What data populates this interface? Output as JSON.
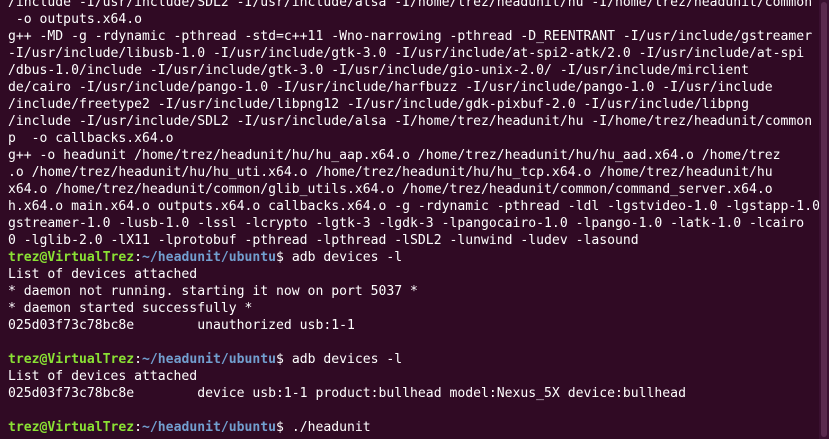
{
  "terminal": {
    "background": "#300a24",
    "text_color": "#ffffff",
    "prompt_user_color": "#8ae234",
    "prompt_path_color": "#729fcf",
    "lines": [
      "/include -I/usr/include/SDL2 -I/usr/include/alsa -I/home/trez/headunit/hu -I/home/trez/headunit/common",
      " -o outputs.x64.o",
      "g++ -MD -g -rdynamic -pthread -std=c++11 -Wno-narrowing -pthread -D_REENTRANT -I/usr/include/gstreamer",
      "-I/usr/include/libusb-1.0 -I/usr/include/gtk-3.0 -I/usr/include/at-spi2-atk/2.0 -I/usr/include/at-spi",
      "/dbus-1.0/include -I/usr/include/gtk-3.0 -I/usr/include/gio-unix-2.0/ -I/usr/include/mirclient",
      "de/cairo -I/usr/include/pango-1.0 -I/usr/include/harfbuzz -I/usr/include/pango-1.0 -I/usr/include",
      "/include/freetype2 -I/usr/include/libpng12 -I/usr/include/gdk-pixbuf-2.0 -I/usr/include/libpng",
      "/include -I/usr/include/SDL2 -I/usr/include/alsa -I/home/trez/headunit/hu -I/home/trez/headunit/common",
      "p  -o callbacks.x64.o",
      "g++ -o headunit /home/trez/headunit/hu/hu_aap.x64.o /home/trez/headunit/hu/hu_aad.x64.o /home/trez",
      ".o /home/trez/headunit/hu/hu_uti.x64.o /home/trez/headunit/hu/hu_tcp.x64.o /home/trez/headunit/hu",
      "x64.o /home/trez/headunit/common/glib_utils.x64.o /home/trez/headunit/common/command_server.x64.o",
      "h.x64.o main.x64.o outputs.x64.o callbacks.x64.o -g -rdynamic -pthread -ldl -lgstvideo-1.0 -lgstapp-1.0",
      "gstreamer-1.0 -lusb-1.0 -lssl -lcrypto -lgtk-3 -lgdk-3 -lpangocairo-1.0 -lpango-1.0 -latk-1.0 -lcairo",
      "0 -lglib-2.0 -lX11 -lprotobuf -pthread -lpthread -lSDL2 -lunwind -ludev -lasound",
      {
        "user": "trez@VirtualTrez",
        "sep": ":",
        "path": "~/headunit/ubuntu",
        "symbol": "$",
        "cmd": " adb devices -l"
      },
      "List of devices attached",
      "* daemon not running. starting it now on port 5037 *",
      "* daemon started successfully *",
      "025d03f73c78bc8e        unauthorized usb:1-1",
      "",
      {
        "user": "trez@VirtualTrez",
        "sep": ":",
        "path": "~/headunit/ubuntu",
        "symbol": "$",
        "cmd": " adb devices -l"
      },
      "List of devices attached",
      "025d03f73c78bc8e        device usb:1-1 product:bullhead model:Nexus_5X device:bullhead",
      "",
      {
        "user": "trez@VirtualTrez",
        "sep": ":",
        "path": "~/headunit/ubuntu",
        "symbol": "$",
        "cmd": " ./headunit"
      }
    ]
  }
}
